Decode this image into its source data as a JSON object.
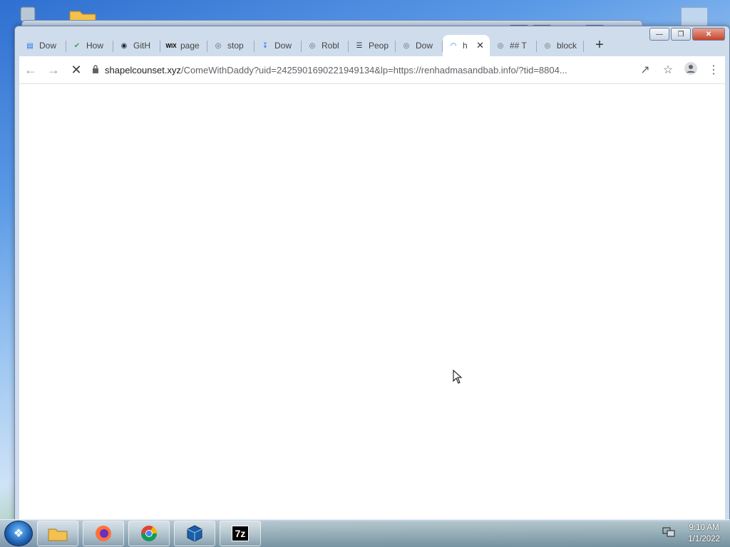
{
  "browser": {
    "tabs": [
      {
        "label": "Dow",
        "icon": "chart-icon",
        "color": "#1a73e8"
      },
      {
        "label": "How",
        "icon": "shield-check-icon",
        "color": "#34a853"
      },
      {
        "label": "GitH",
        "icon": "github-icon",
        "color": "#24292e"
      },
      {
        "label": "page",
        "icon": "wix-icon",
        "color": "#000000"
      },
      {
        "label": "stop",
        "icon": "globe-icon",
        "color": "#5f6368"
      },
      {
        "label": "Dow",
        "icon": "download-icon",
        "color": "#1a73e8"
      },
      {
        "label": "Robl",
        "icon": "globe-icon",
        "color": "#5f6368"
      },
      {
        "label": "Peop",
        "icon": "people-icon",
        "color": "#333333"
      },
      {
        "label": "Dow",
        "icon": "globe-icon",
        "color": "#5f6368"
      },
      {
        "label": "h",
        "icon": "loading-spinner-icon",
        "color": "#1a73e8",
        "active": true
      },
      {
        "label": "## T",
        "icon": "globe-icon",
        "color": "#5f6368"
      },
      {
        "label": "block",
        "icon": "globe-icon",
        "color": "#5f6368"
      }
    ],
    "address": {
      "host": "shapelcounset.xyz",
      "path": "/ComeWithDaddy?uid=2425901690221949134&lp=https://renhadmasandbab.info/?tid=8804..."
    }
  },
  "taskbar": {
    "apps": [
      "file-explorer-icon",
      "firefox-icon",
      "chrome-icon",
      "virtualbox-icon",
      "7zip-icon"
    ],
    "sevenzip_label": "7z",
    "time": "9:10 AM",
    "date": "1/1/2022"
  }
}
